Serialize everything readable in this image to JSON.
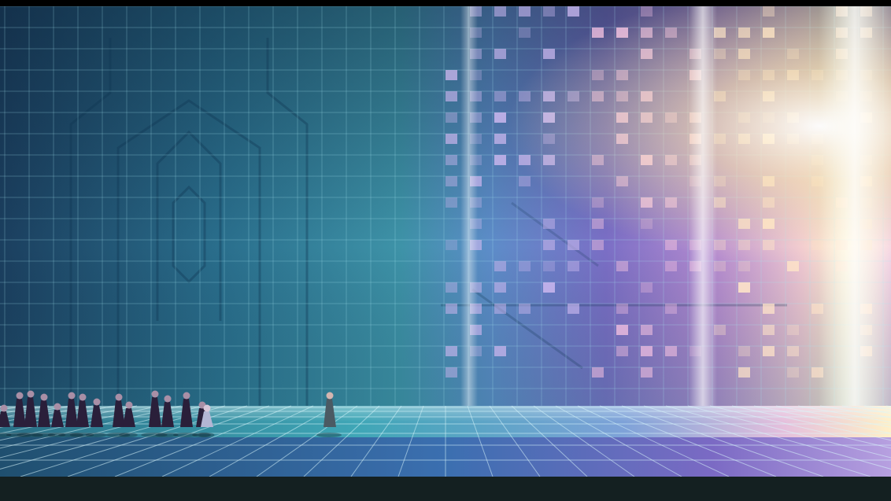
{
  "scene": {
    "description_visible_text": "",
    "colors": {
      "wall_left": "#1d4f6e",
      "wall_mid": "#2f8fa0",
      "wall_violet": "#7b6fc6",
      "wall_pink": "#d79bc9",
      "light_core": "#fff7d6",
      "floor_left": "#2a7a8f",
      "floor_right": "#b89bd8",
      "grid_line": "#a7e6ef",
      "robe_dark": "#2a1f3a",
      "robe_leader": "#4b5a63",
      "letterbox_top": "#000000",
      "letterbox_bottom": "#142021"
    },
    "procession": {
      "follower_count": 16,
      "leader_count": 1
    }
  }
}
